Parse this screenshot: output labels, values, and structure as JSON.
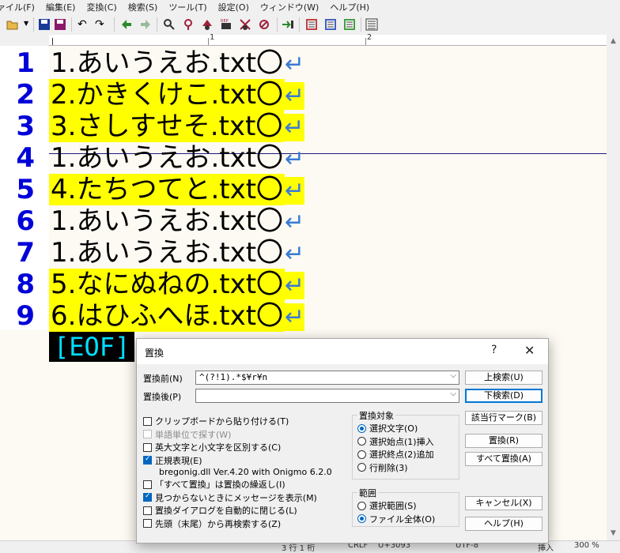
{
  "menu": [
    "ァイル(F)",
    "編集(E)",
    "変換(C)",
    "検索(S)",
    "ツール(T)",
    "設定(O)",
    "ウィンドウ(W)",
    "ヘルプ(H)"
  ],
  "ruler": {
    "marks": [
      "1",
      "2"
    ]
  },
  "editor": {
    "lines": [
      {
        "num": "1",
        "text": "1.あいうえお.txt〇",
        "highlight": false
      },
      {
        "num": "2",
        "text": "2.かきくけこ.txt〇",
        "highlight": true
      },
      {
        "num": "3",
        "text": "3.さしすせそ.txt〇",
        "highlight": true
      },
      {
        "num": "4",
        "text": "1.あいうえお.txt〇",
        "highlight": false
      },
      {
        "num": "5",
        "text": "4.たちつてと.txt〇",
        "highlight": true
      },
      {
        "num": "6",
        "text": "1.あいうえお.txt〇",
        "highlight": false
      },
      {
        "num": "7",
        "text": "1.あいうえお.txt〇",
        "highlight": false
      },
      {
        "num": "8",
        "text": "5.なにぬねの.txt〇",
        "highlight": true
      },
      {
        "num": "9",
        "text": "6.はひふへほ.txt〇",
        "highlight": true
      }
    ],
    "return_mark": "↵",
    "eof": "[EOF]",
    "highlight_color": "#ffff00"
  },
  "status": {
    "position": "3 行    1 桁",
    "eol": "CRLF",
    "code": "U+3093",
    "encoding": "UTF-8",
    "mode": "挿入",
    "zoom": "300 %"
  },
  "dialog": {
    "title": "置換",
    "help_glyph": "?",
    "close_glyph": "✕",
    "find_label": "置換前(N)",
    "find_value": "^(?!1).*$¥r¥n",
    "replace_label": "置換後(P)",
    "replace_value": "",
    "buttons": {
      "find_up": "上検索(U)",
      "find_down": "下検索(D)",
      "mark_lines": "該当行マーク(B)",
      "replace": "置換(R)",
      "replace_all": "すべて置換(A)",
      "cancel": "キャンセル(X)",
      "help": "ヘルプ(H)"
    },
    "options": [
      {
        "label": "クリップボードから貼り付ける(T)",
        "checked": false,
        "disabled": false
      },
      {
        "label": "単語単位で探す(W)",
        "checked": false,
        "disabled": true
      },
      {
        "label": "英大文字と小文字を区別する(C)",
        "checked": false,
        "disabled": false
      },
      {
        "label": "正規表現(E)",
        "checked": true,
        "disabled": false
      }
    ],
    "regex_lib": "bregonig.dll Ver.4.20 with Onigmo 6.2.0",
    "options2": [
      {
        "label": "「すべて置換」は置換の繰返し(I)",
        "checked": false
      },
      {
        "label": "見つからないときにメッセージを表示(M)",
        "checked": true
      },
      {
        "label": "置換ダイアログを自動的に閉じる(L)",
        "checked": false
      },
      {
        "label": "先頭（末尾）から再検索する(Z)",
        "checked": false
      }
    ],
    "target_group": {
      "caption": "置換対象",
      "items": [
        {
          "label": "選択文字(O)",
          "selected": true
        },
        {
          "label": "選択始点(1)挿入",
          "selected": false
        },
        {
          "label": "選択終点(2)追加",
          "selected": false
        },
        {
          "label": "行削除(3)",
          "selected": false
        }
      ]
    },
    "range_group": {
      "caption": "範囲",
      "items": [
        {
          "label": "選択範囲(S)",
          "selected": false
        },
        {
          "label": "ファイル全体(O)",
          "selected": true
        }
      ]
    }
  }
}
